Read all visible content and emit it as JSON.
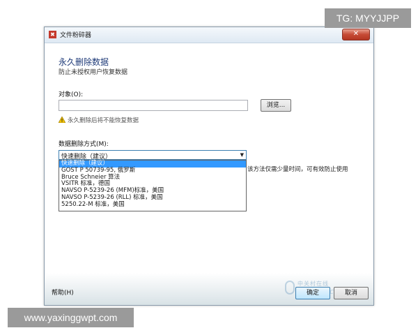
{
  "window": {
    "title": "文件粉碎器",
    "close_symbol": "✕",
    "heading": "永久删除数据",
    "subheading": "防止未授权用户恢复数据"
  },
  "target": {
    "label": "对象(O):",
    "value": "",
    "browse_label": "浏览..."
  },
  "warning": {
    "text": "永久删除后将不能恢复数据",
    "icon": "warning-icon"
  },
  "method": {
    "label": "数据删除方式(M):",
    "selected": "快速删除（建议）",
    "options": [
      "快速删除（建议）",
      "GOST P 50739-95, 俄罗斯",
      "Bruce Schneier 算法",
      "VSITR 标准，德国",
      "NAVSO P-5239-26 (MFM)标准，美国",
      "NAVSO P-5239-26 (RLL) 标准，美国",
      "5250.22-M 标准，美国"
    ],
    "description_tail": "该方法仅需少量时间，可有效防止使用"
  },
  "footer": {
    "help_label": "帮助(H)",
    "ok_label": "确定",
    "cancel_label": "取消",
    "logo_top": "中关村在线",
    "logo_bottom": "zol.com.cn"
  },
  "watermarks": {
    "tg": "TG: MYYJJPP",
    "url": "www.yaxinggwpt.com"
  },
  "colors": {
    "selection": "#3399ff",
    "heading": "#1e3a78",
    "close_button": "#c64a35"
  }
}
